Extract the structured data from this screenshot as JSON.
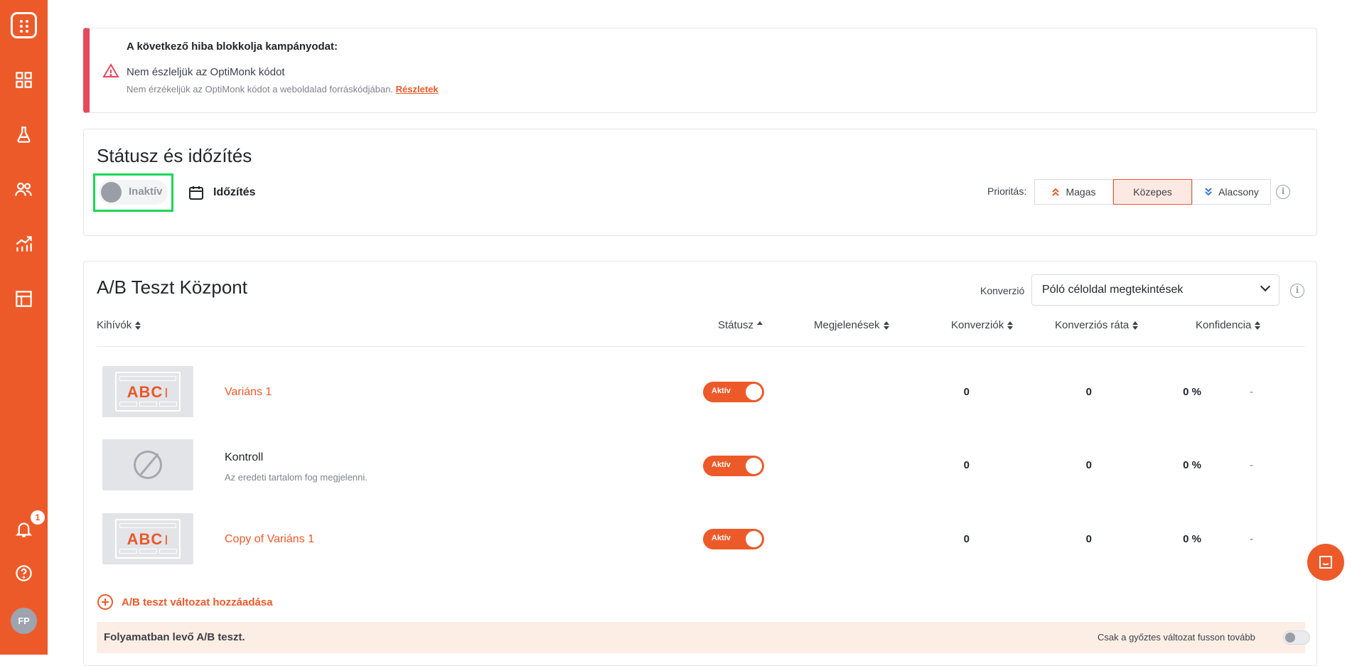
{
  "sidebar": {
    "notification_count": "1",
    "avatar_initials": "FP",
    "icons": [
      "dashboard-icon",
      "flask-icon",
      "users-icon",
      "analytics-icon",
      "layout-icon",
      "bell-icon",
      "help-icon"
    ]
  },
  "alert": {
    "title": "A következő hiba blokkolja kampányodat:",
    "message": "Nem észleljük az OptiMonk kódot",
    "description": "Nem érzékeljük az OptiMonk kódot a weboldalad forráskódjában.",
    "link": "Részletek"
  },
  "status": {
    "title": "Státusz és időzítés",
    "toggle_label": "Inaktív",
    "timing_label": "Időzítés",
    "priority_label": "Prioritás:",
    "priority_options": [
      "Magas",
      "Közepes",
      "Alacsony"
    ],
    "priority_selected": "Közepes"
  },
  "ab": {
    "title": "A/B Teszt Központ",
    "conversion_label": "Konverzió",
    "conversion_value": "Póló céloldal megtekintések",
    "columns": {
      "challengers": "Kihívók",
      "status": "Státusz",
      "impressions": "Megjelenések",
      "conversions": "Konverziók",
      "conversion_rate": "Konverziós ráta",
      "confidence": "Konfidencia"
    },
    "rows": [
      {
        "name": "Variáns 1",
        "description": "",
        "status": "Aktív",
        "impressions": "0",
        "conversions": "0",
        "rate": "0 %",
        "confidence": "-",
        "thumb_text": "ABC"
      },
      {
        "name": "Kontroll",
        "description": "Az eredeti tartalom fog megjelenni.",
        "status": "Aktív",
        "impressions": "0",
        "conversions": "0",
        "rate": "0 %",
        "confidence": "-",
        "thumb_text": ""
      },
      {
        "name": "Copy of Variáns 1",
        "description": "",
        "status": "Aktív",
        "impressions": "0",
        "conversions": "0",
        "rate": "0 %",
        "confidence": "-",
        "thumb_text": "ABC"
      }
    ],
    "add_variant": "A/B teszt változat hozzáadása",
    "running_text": "Folyamatban levő A/B teszt.",
    "winner_only_text": "Csak a győztes változat fusson tovább"
  },
  "colors": {
    "brand": "#ed5a29",
    "alert_red": "#e5495d",
    "highlight_green": "#1bd65a"
  }
}
